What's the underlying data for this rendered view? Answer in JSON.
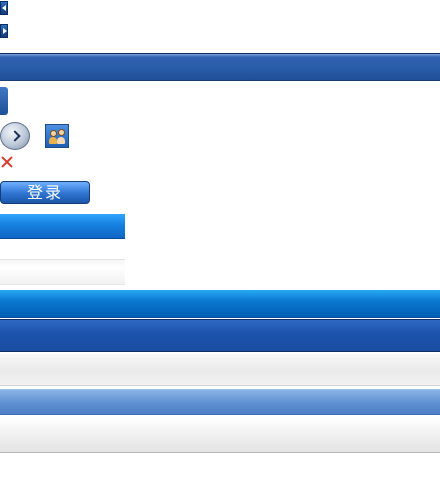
{
  "controls": {
    "login_label": "登录"
  },
  "icons": {
    "left_arrow": "triangle-left-icon",
    "right_arrow": "triangle-right-icon",
    "circle_next": "circle-chevron-right-icon",
    "users": "users-icon",
    "close": "close-icon"
  },
  "colors": {
    "dark_blue": "#1f4f97",
    "bright_blue": "#0b79cf",
    "light_blue": "#5f90d2",
    "red_x": "#d73a2a"
  }
}
